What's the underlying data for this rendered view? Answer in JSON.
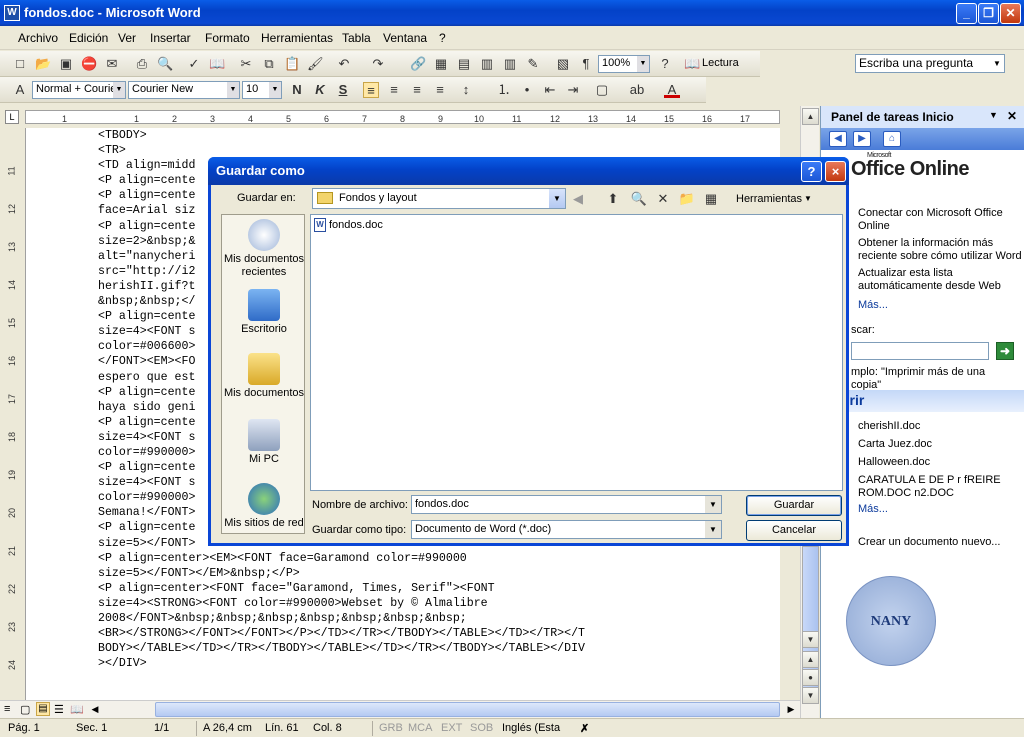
{
  "window": {
    "title": "fondos.doc - Microsoft Word",
    "app_icon": "W"
  },
  "menu": {
    "items": [
      "Archivo",
      "Edición",
      "Ver",
      "Insertar",
      "Formato",
      "Herramientas",
      "Tabla",
      "Ventana",
      "?"
    ],
    "ask_placeholder": "Escriba una pregunta"
  },
  "toolbar": {
    "zoom": "100%",
    "reading": "Lectura",
    "style": "Normal + Courie",
    "font": "Courier New",
    "size": "10"
  },
  "ruler": {
    "numbers": [
      "1",
      "1",
      "2",
      "3",
      "4",
      "5",
      "6",
      "7",
      "8",
      "9",
      "10",
      "11",
      "12",
      "13",
      "14",
      "15",
      "16",
      "17"
    ]
  },
  "vruler": {
    "numbers": [
      "11",
      "12",
      "13",
      "14",
      "15",
      "16",
      "17",
      "18",
      "19",
      "20",
      "21",
      "22",
      "23",
      "24"
    ]
  },
  "document": {
    "lines": [
      "<TBODY>",
      "<TR>",
      "<TD align=midd",
      "<P align=cente",
      "<P align=cente",
      "face=Arial siz",
      "<P align=cente",
      "size=2>&nbsp;&",
      "alt=\"nanycheri",
      "src=\"http://i2",
      "herishII.gif?t",
      "&nbsp;&nbsp;</",
      "<P align=cente",
      "size=4><FONT s",
      "color=#006600>",
      "</FONT><EM><FO",
      "espero que est",
      "<P align=cente",
      "haya sido geni",
      "<P align=cente",
      "size=4><FONT s",
      "color=#990000>",
      "<P align=cente",
      "size=4><FONT s",
      "color=#990000>",
      "Semana!</FONT>",
      "<P align=cente",
      "size=5></FONT>",
      "<P align=center><EM><FONT face=Garamond color=#990000",
      "size=5></FONT></EM>&nbsp;</P>",
      "<P align=center><FONT face=\"Garamond, Times, Serif\"><FONT",
      "size=4><STRONG><FONT color=#990000>Webset by © Almalibre",
      "2008</FONT>&nbsp;&nbsp;&nbsp;&nbsp;&nbsp;&nbsp;&nbsp;",
      "<BR></STRONG></FONT></FONT></P></TD></TR></TBODY></TABLE></TD></TR></T",
      "BODY></TABLE></TD></TR></TBODY></TABLE></TD></TR></TBODY></TABLE></DIV",
      "></DIV>"
    ]
  },
  "status": {
    "page": "Pág. 1",
    "section": "Sec. 1",
    "pages": "1/1",
    "at": "A 26,4 cm",
    "line": "Lín. 61",
    "col": "Col. 8",
    "grb": "GRB",
    "mca": "MCA",
    "ext": "EXT",
    "sob": "SOB",
    "lang": "Inglés (Esta"
  },
  "taskpane": {
    "title": "Panel de tareas Inicio",
    "logo_small": "Microsoft",
    "logo": "Office Online",
    "links": [
      "Conectar con Microsoft Office Online",
      "Obtener la información más reciente sobre cómo utilizar Word",
      "Actualizar esta lista automáticamente desde Web"
    ],
    "more1": "Más...",
    "search_label": "scar:",
    "example": "mplo: \"Imprimir más de una copia\"",
    "open_section": "orir",
    "recent_files": [
      "cherishII.doc",
      "Carta Juez.doc",
      "Halloween.doc",
      "CARATULA E DE P r fREIRE ROM.DOC n2.DOC"
    ],
    "more2": "Más...",
    "new_doc": "Crear un documento nuevo...",
    "emblem": "NANY"
  },
  "dialog": {
    "title": "Guardar como",
    "help": "?",
    "close": "×",
    "save_in_label": "Guardar en:",
    "save_in_value": "Fondos y layout",
    "tools_label": "Herramientas",
    "places": [
      "Mis documentos recientes",
      "Escritorio",
      "Mis documentos",
      "Mi PC",
      "Mis sitios de red"
    ],
    "files": [
      "fondos.doc"
    ],
    "filename_label": "Nombre de archivo:",
    "filename_value": "fondos.doc",
    "filetype_label": "Guardar como tipo:",
    "filetype_value": "Documento de Word (*.doc)",
    "save_button": "Guardar",
    "cancel_button": "Cancelar"
  }
}
